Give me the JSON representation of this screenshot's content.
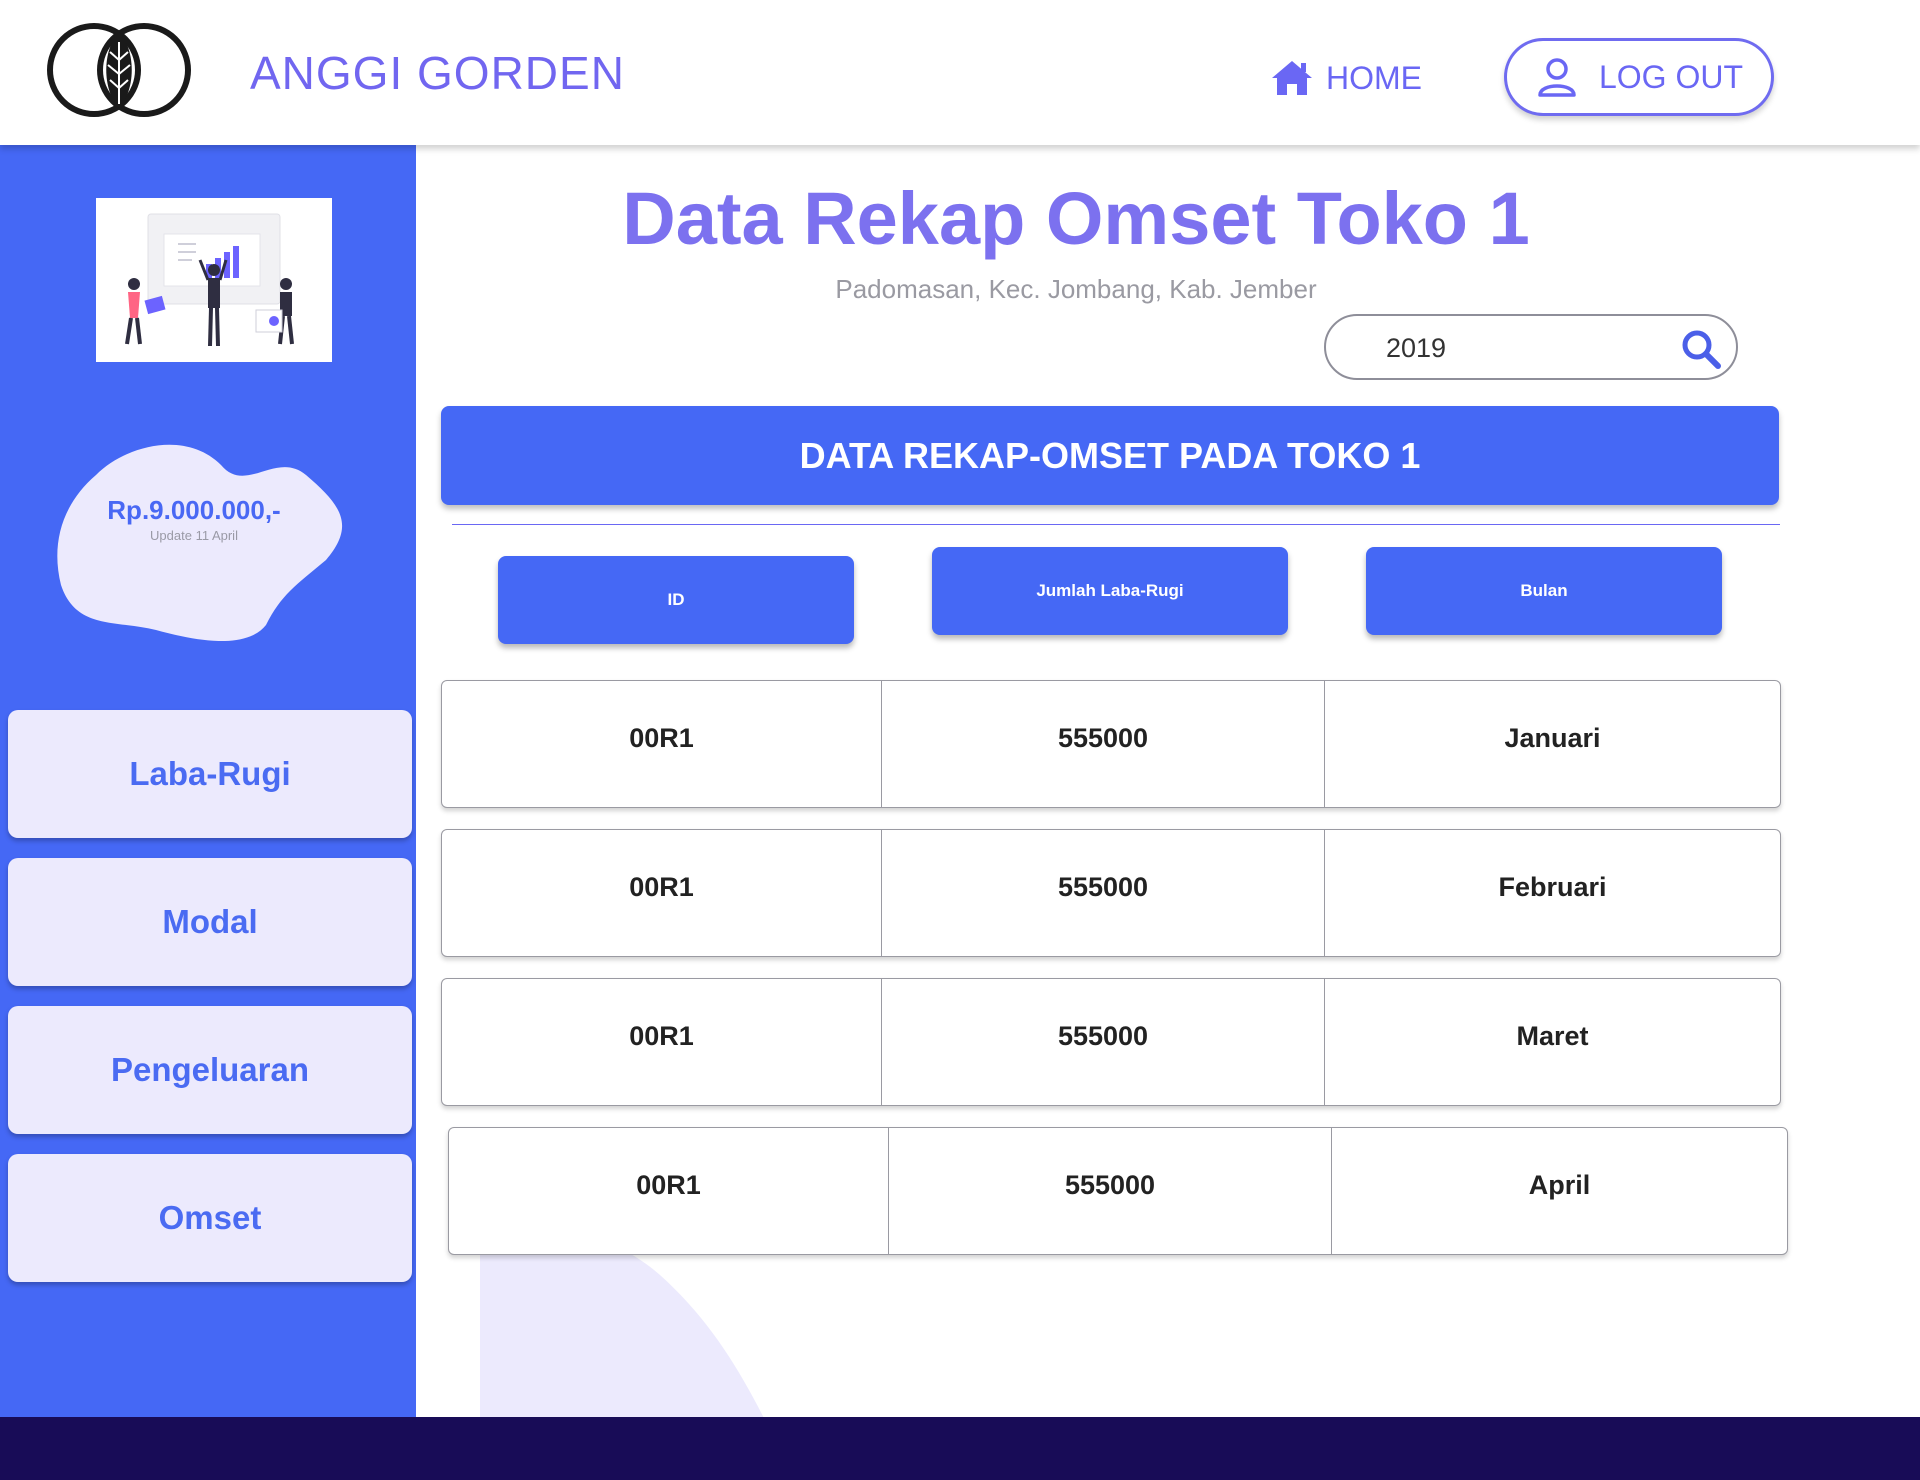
{
  "header": {
    "brand": "ANGGI GORDEN",
    "home_label": "HOME",
    "logout_label": "LOG OUT"
  },
  "sidebar": {
    "balance_amount": "Rp.9.000.000,-",
    "balance_update": "Update 11 April",
    "nav": [
      {
        "label": "Laba-Rugi"
      },
      {
        "label": "Modal"
      },
      {
        "label": "Pengeluaran"
      },
      {
        "label": "Omset"
      }
    ]
  },
  "main": {
    "title": "Data Rekap Omset Toko 1",
    "subtitle": "Padomasan, Kec. Jombang, Kab. Jember",
    "search_value": "2019",
    "banner": "DATA REKAP-OMSET PADA TOKO 1",
    "columns": [
      "ID",
      "Jumlah Laba-Rugi",
      "Bulan"
    ],
    "rows": [
      [
        "00R1",
        "555000",
        "Januari"
      ],
      [
        "00R1",
        "555000",
        "Februari"
      ],
      [
        "00R1",
        "555000",
        "Maret"
      ],
      [
        "00R1",
        "555000",
        "April"
      ]
    ]
  },
  "colors": {
    "accent": "#4568f5",
    "brand_text": "#7166f0",
    "nav_bg": "#eceafd",
    "footer": "#180c57"
  },
  "icons": [
    "logo-icon",
    "home-icon",
    "user-icon",
    "search-icon",
    "analytics-illustration"
  ]
}
